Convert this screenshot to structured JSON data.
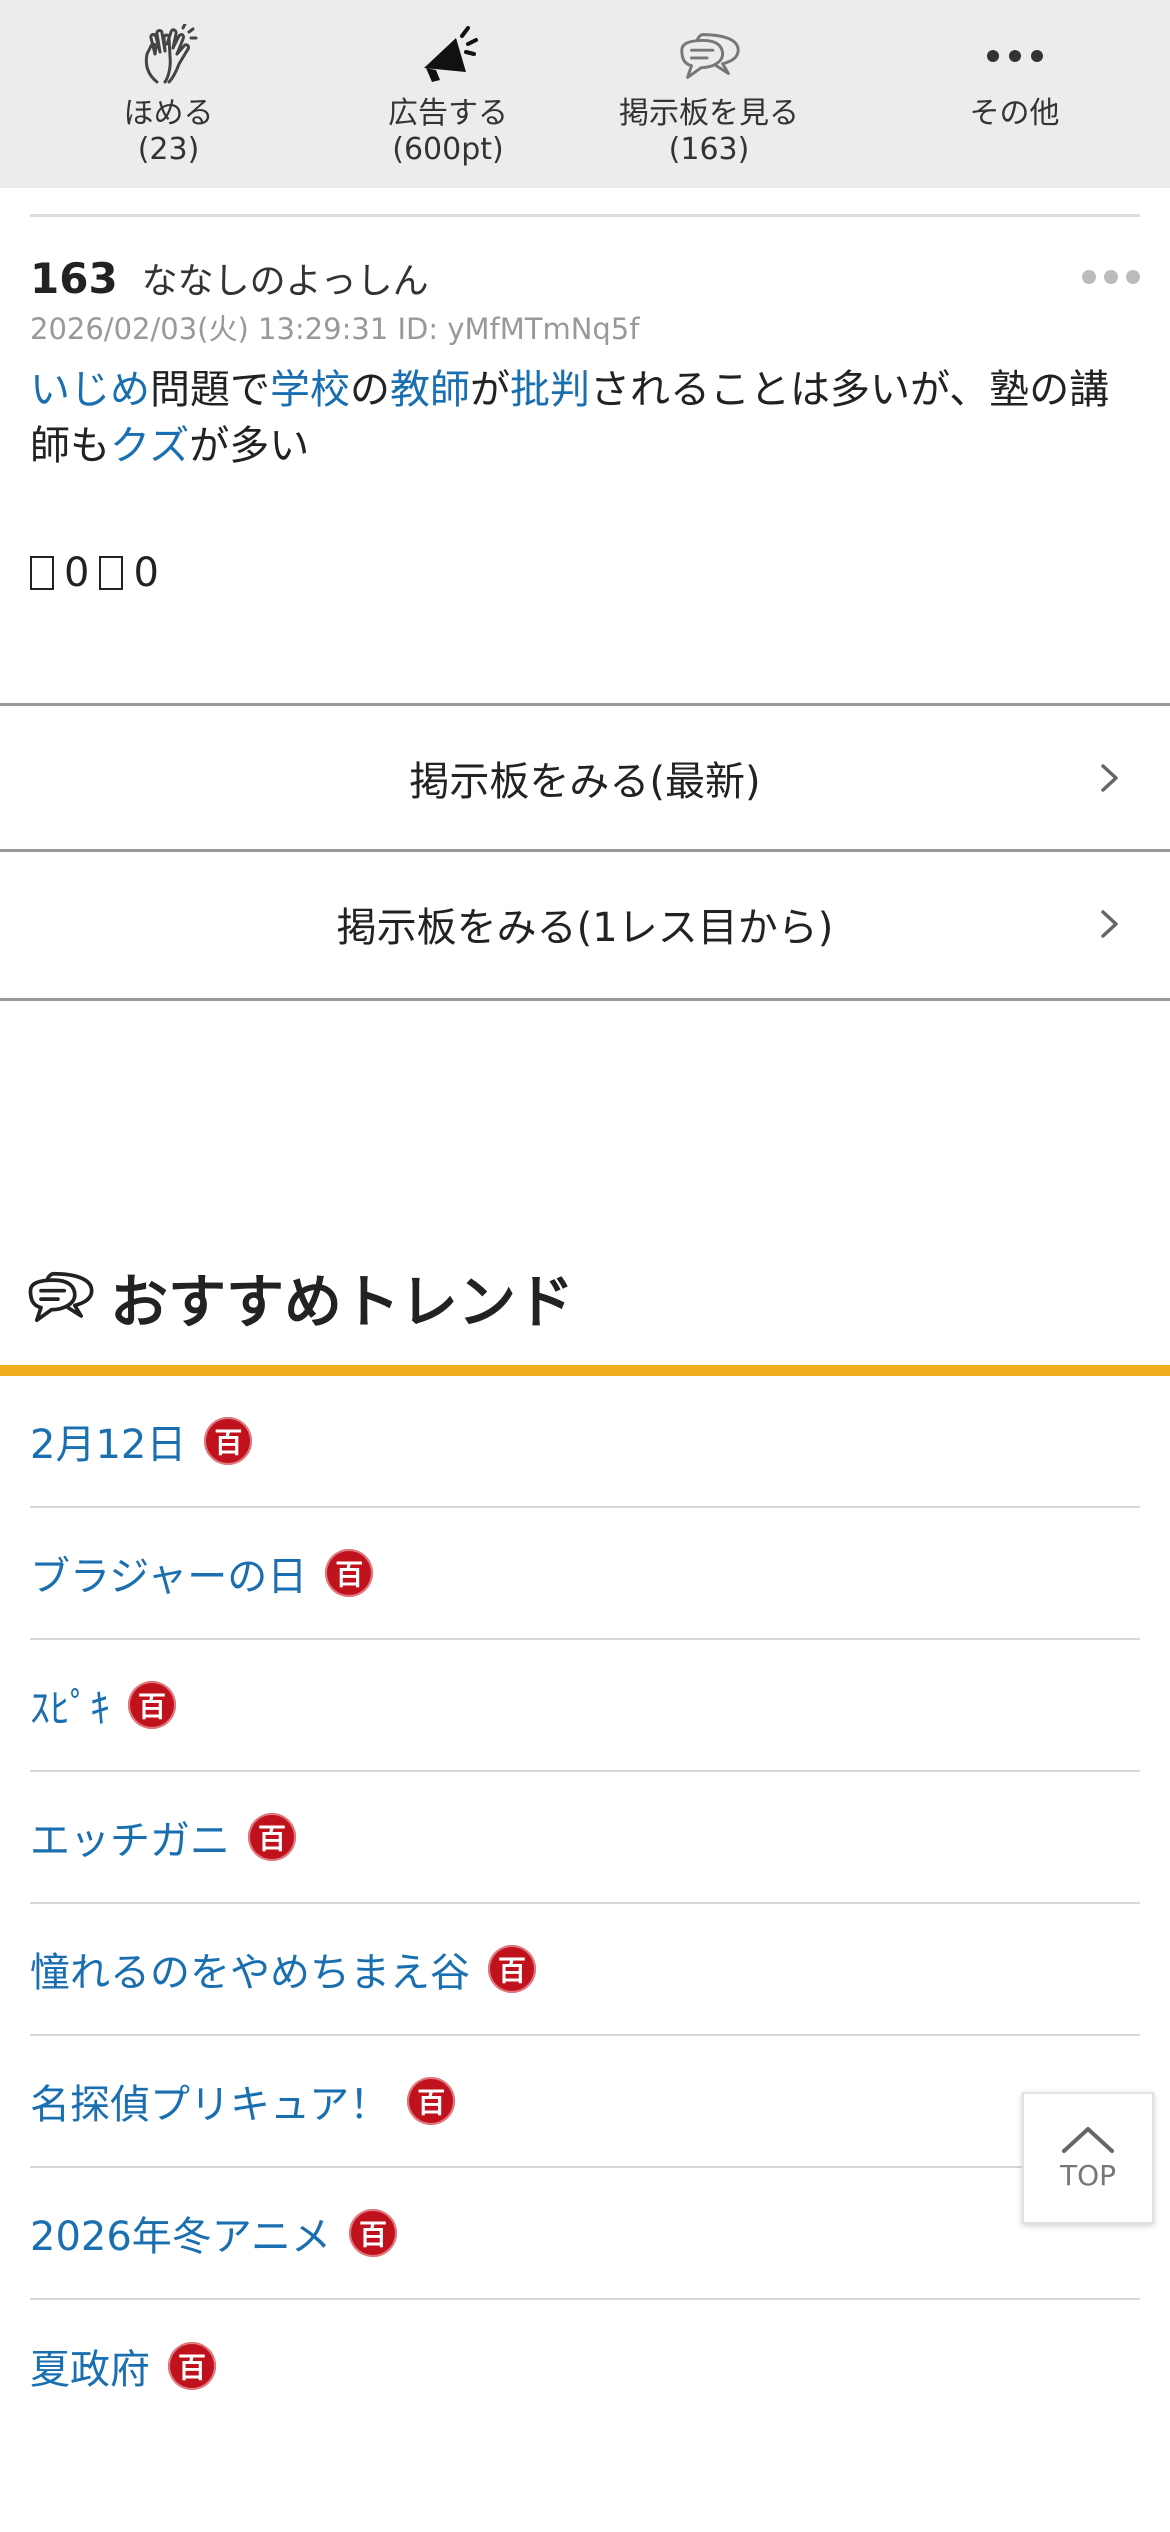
{
  "actions": [
    {
      "label": "ほめる",
      "count": "(23)",
      "icon": "clap-hands-icon"
    },
    {
      "label": "広告する",
      "count": "(600pt)",
      "icon": "megaphone-icon"
    },
    {
      "label": "掲示板を見る",
      "count": "(163)",
      "icon": "chat-bubbles-icon"
    },
    {
      "label": "その他",
      "count": "",
      "icon": "more-dots-icon"
    }
  ],
  "post": {
    "number": "163",
    "name": "ななしのよっしん",
    "meta": "2026/02/03(火) 13:29:31 ID: yMfMTmNq5f",
    "body": [
      {
        "t": "いじめ",
        "link": true
      },
      {
        "t": "問題で",
        "link": false
      },
      {
        "t": "学校",
        "link": true
      },
      {
        "t": "の",
        "link": false
      },
      {
        "t": "教師",
        "link": true
      },
      {
        "t": "が",
        "link": false
      },
      {
        "t": "批判",
        "link": true
      },
      {
        "t": "されることは多いが、塾の講師も",
        "link": false
      },
      {
        "t": "クズ",
        "link": true
      },
      {
        "t": "が多い",
        "link": false
      }
    ],
    "votes": {
      "up": "0",
      "down": "0"
    }
  },
  "board_links": [
    {
      "label": "掲示板をみる(最新)"
    },
    {
      "label": "掲示板をみる(1レス目から)"
    }
  ],
  "trends": {
    "title": "おすすめトレンド",
    "badge": "百",
    "items": [
      "2月12日",
      "ブラジャーの日",
      "ｽﾋﾟｷ",
      "エッチガニ",
      "憧れるのをやめちまえ谷",
      "名探偵プリキュア！",
      "2026年冬アニメ",
      "夏政府"
    ]
  },
  "top_button": {
    "label": "TOP"
  },
  "colors": {
    "link": "#1a6fb0",
    "accent": "#f2ad1c",
    "badge": "#c0121d",
    "bar_bg": "#ececec"
  }
}
